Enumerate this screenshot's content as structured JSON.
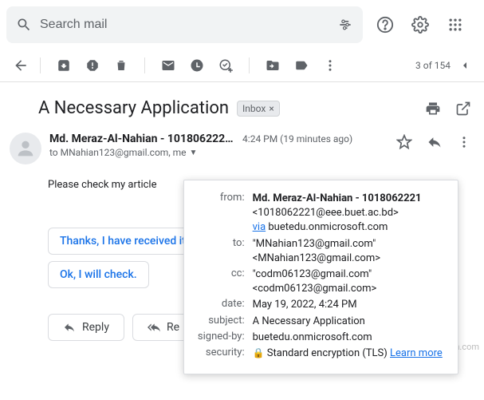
{
  "search": {
    "placeholder": "Search mail"
  },
  "pagination": {
    "text": "3 of 154"
  },
  "subject": {
    "title": "A Necessary Application",
    "label": "Inbox"
  },
  "sender": {
    "display": "Md. Meraz-Al-Nahian - 1018062221",
    "display_trunc": "Md. Meraz-Al-Nahian - 101806222…",
    "time": "4:24 PM (19 minutes ago)"
  },
  "recipients": {
    "line": "to MNahian123@gmail.com, me"
  },
  "body": {
    "text": "Please check my article"
  },
  "smart_replies": {
    "one": "Thanks, I have received it.",
    "two": "Ok, I will check."
  },
  "actions": {
    "reply": "Reply",
    "reply_all": "Reply all"
  },
  "details": {
    "from_label": "from:",
    "from_name": "Md. Meraz-Al-Nahian - 1018062221",
    "from_addr": "<1018062221@eee.buet.ac.bd>",
    "via": "via",
    "via_domain": "buetedu.onmicrosoft.com",
    "to_label": "to:",
    "to_name": "\"MNahian123@gmail.com\"",
    "to_addr": "<MNahian123@gmail.com>",
    "cc_label": "cc:",
    "cc_name": "\"codm06123@gmail.com\"",
    "cc_addr": "<codm06123@gmail.com>",
    "date_label": "date:",
    "date": "May 19, 2022, 4:24 PM",
    "subject_label": "subject:",
    "subject": "A Necessary Application",
    "signed_label": "signed-by:",
    "signed": "buetedu.onmicrosoft.com",
    "security_label": "security:",
    "security": "Standard encryption (TLS)",
    "learn": "Learn more"
  },
  "watermark": "wsxdn.com"
}
